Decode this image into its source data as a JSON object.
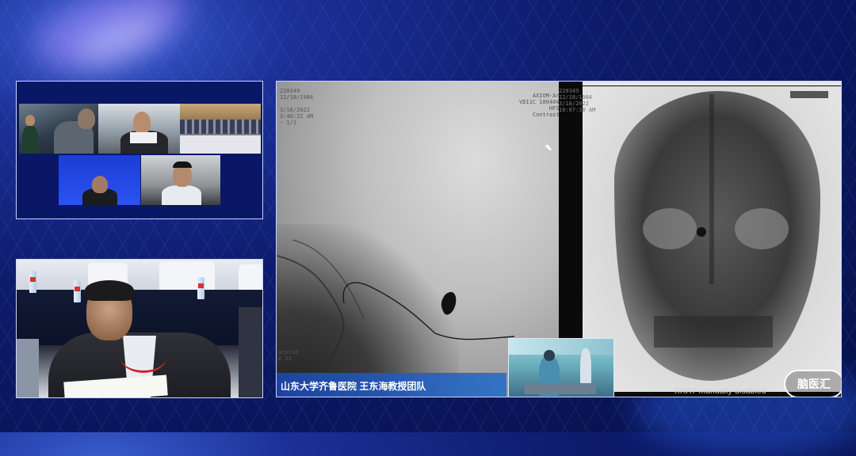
{
  "stream": {
    "caption": "山东大学齐鲁医院 王东海教授团队",
    "xray_status": "XRAY manually disabled",
    "watermark_logo": "脑医汇"
  },
  "dicom_left": {
    "lines": [
      "220349",
      "12/18/1984",
      "",
      "3/18/2022",
      "3:40:22 AM",
      "- 1/1"
    ],
    "top_right": [
      "AXIOM-Ar",
      "VD11C 180404",
      "HFS",
      "Contrast"
    ],
    "bottom_left": [
      "arotid",
      "e 22"
    ]
  },
  "dicom_right": {
    "lines": [
      "220349",
      "12/18/1984",
      "3/18/2022",
      "10:07:30 AM"
    ]
  },
  "video_grid": {
    "tiles": [
      {
        "name": "tile-1",
        "label": ""
      },
      {
        "name": "tile-2",
        "label": ""
      },
      {
        "name": "tile-3",
        "label": ""
      },
      {
        "name": "tile-4",
        "label": ""
      },
      {
        "name": "tile-5",
        "label": ""
      }
    ]
  },
  "colors": {
    "background": "#0d1b6b",
    "panel_border": "#c8d6ff",
    "caption_bg": "#1e46aa"
  }
}
